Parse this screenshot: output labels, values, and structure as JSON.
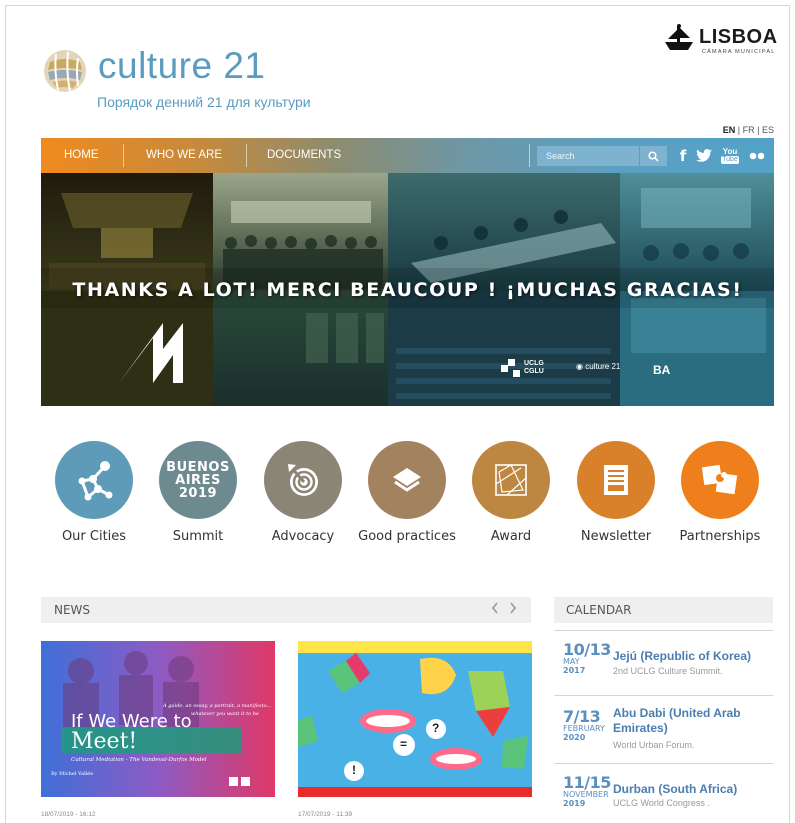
{
  "header": {
    "logo_title": "culture 21",
    "logo_subtitle": "Порядок денний 21 для культури",
    "partner_name": "LISBOA",
    "partner_sub": "CÂMARA MUNICIPAL"
  },
  "languages": [
    {
      "label": "EN",
      "active": true
    },
    {
      "label": "FR",
      "active": false
    },
    {
      "label": "ES",
      "active": false
    }
  ],
  "lang_separator": "|",
  "nav": {
    "items": [
      {
        "label": "HOME"
      },
      {
        "label": "WHO WE ARE"
      },
      {
        "label": "DOCUMENTS"
      }
    ],
    "search_placeholder": "Search",
    "social": [
      "facebook-icon",
      "twitter-icon",
      "youtube-icon",
      "flickr-icon"
    ],
    "youtube_top": "You",
    "youtube_bottom": "Tube"
  },
  "banner": {
    "headline": "THANKS A LOT!  MERCI BEAUCOUP !  ¡MUCHAS GRACIAS!",
    "logo_uclg": "UCLG",
    "logo_cglu": "CGLU",
    "logo_culture": "culture 21",
    "logo_ba": "BA"
  },
  "circles": [
    {
      "label": "Our Cities",
      "color": "#5e9bb9",
      "icon": "network-icon"
    },
    {
      "label": "Summit",
      "color": "#6c8a8f",
      "icon": "buenos-aires-badge",
      "badge": [
        "BUENOS",
        "AIRES",
        "2019"
      ]
    },
    {
      "label": "Advocacy",
      "color": "#8b8575",
      "icon": "target-icon"
    },
    {
      "label": "Good practices",
      "color": "#a2825f",
      "icon": "layers-icon"
    },
    {
      "label": "Award",
      "color": "#bd8641",
      "icon": "award-icon"
    },
    {
      "label": "Newsletter",
      "color": "#d9802b",
      "icon": "newsletter-icon"
    },
    {
      "label": "Partnerships",
      "color": "#ef7f1a",
      "icon": "puzzle-icon"
    }
  ],
  "news": {
    "title": "NEWS",
    "items": [
      {
        "date": "18/07/2019 - 16:12",
        "image_caption_top": "A guide, an essay, a portrait, a manifesto...",
        "image_caption_top2": "whatever you want it to be",
        "image_title_1": "If We Were to",
        "image_title_2": "Meet!",
        "image_subtitle": "Cultural Mediation - The Vandeval-Durfos Model",
        "image_author": "By Michel Vallée"
      },
      {
        "date": "17/07/2019 - 11:39"
      }
    ]
  },
  "calendar": {
    "title": "CALENDAR",
    "events": [
      {
        "range": "10/13",
        "month": "MAY",
        "year": "2017",
        "place": "Jejú (Republic of Korea)",
        "desc": "2nd UCLG Culture Summit."
      },
      {
        "range": "7/13",
        "month": "FEBRUARY",
        "year": "2020",
        "place": "Abu Dabi (United Arab Emirates)",
        "desc": "World Urban Forum."
      },
      {
        "range": "11/15",
        "month": "NOVEMBER",
        "year": "2019",
        "place": "Durban (South Africa)",
        "desc": "UCLG World Congress ."
      }
    ]
  }
}
